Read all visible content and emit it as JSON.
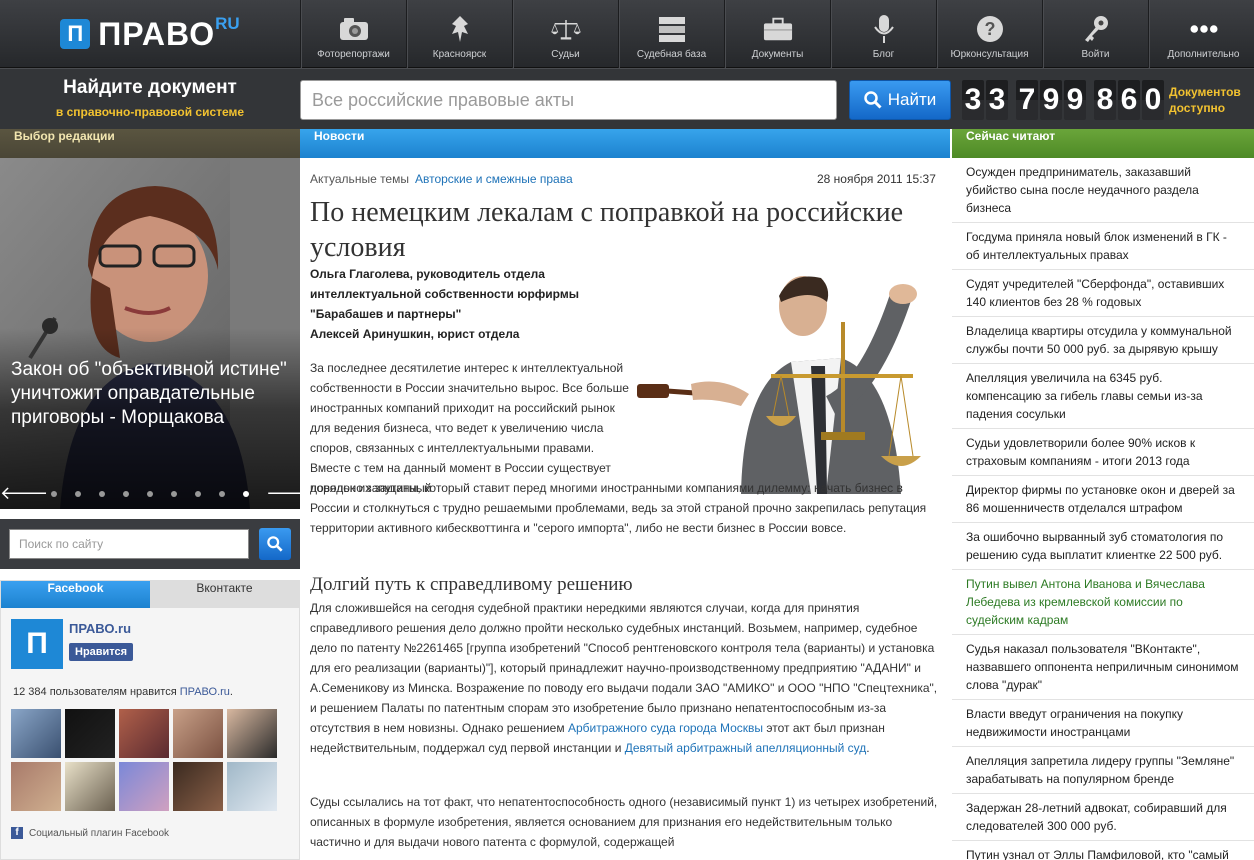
{
  "brand": {
    "mark": "П",
    "name": "ПРАВО",
    "suffix": "RU"
  },
  "nav": [
    {
      "label": "Фоторепортажи",
      "icon": "camera-icon"
    },
    {
      "label": "Красноярск",
      "icon": "city-emblem-icon"
    },
    {
      "label": "Судьи",
      "icon": "scales-icon"
    },
    {
      "label": "Судебная база",
      "icon": "database-icon"
    },
    {
      "label": "Документы",
      "icon": "briefcase-icon"
    },
    {
      "label": "Блог",
      "icon": "microphone-icon"
    },
    {
      "label": "Юрконсультация",
      "icon": "question-icon"
    },
    {
      "label": "Войти",
      "icon": "keys-icon"
    },
    {
      "label": "Дополнительно",
      "icon": "more-dots-icon"
    }
  ],
  "docsearch": {
    "title": "Найдите документ",
    "subtitle": "в справочно-правовой системе",
    "placeholder": "Все российские правовые акты",
    "button": "Найти"
  },
  "counter": {
    "digits": [
      "3",
      "3",
      "7",
      "9",
      "9",
      "8",
      "6",
      "0"
    ],
    "label1": "Документов",
    "label2": "доступно"
  },
  "columns": {
    "left": "Выбор редакции",
    "mid": "Новости",
    "right": "Сейчас читают"
  },
  "feature": {
    "title": "Закон об \"объективной истине\" уничтожит оправдательные приговоры - Морщакова",
    "prev": "🡐",
    "next": "🡒",
    "dots": 9,
    "active_dot": 8
  },
  "sitesearch": {
    "placeholder": "Поиск по сайту"
  },
  "social": {
    "tab_fb": "Facebook",
    "tab_vk": "Вконтакте",
    "fb_mark": "П",
    "page_name": "ПРАВО.ru",
    "like_label": "Нравится",
    "count_text": "12 384 пользователям нравится ",
    "count_link": "ПРАВО.ru",
    "count_end": ".",
    "plugin": "Социальный плагин Facebook",
    "fb_letter": "f"
  },
  "article": {
    "crumb1": "Актуальные темы",
    "crumb2": "Авторские и смежные права",
    "date": "28 ноября 2011 15:37",
    "title": "По немецким лекалам с поправкой на российские условия",
    "authors": [
      "Ольга Глаголева, руководитель отдела",
      "интеллектуальной собственности юрфирмы",
      "\"Барабашев и партнеры\"",
      "Алексей Аринушкин, юрист отдела"
    ],
    "p1": "За последнее десятилетие интерес к интеллектуальной собственности в России значительно вырос. Все больше иностранных компаний приходит на российский рынок для ведения бизнеса, что ведет к увеличению числа споров, связанных с интеллектуальными правами. Вместе с тем на данный момент в России существует довольно запутанный",
    "p1b": "порядок их защиты, который ставит перед многими иностранными компаниями дилемму: начать бизнес в России и столкнуться с трудно решаемыми проблемами, ведь за этой страной прочно закрепилась репутация территории активного кибесквоттинга и \"серого импорта\", либо не вести бизнес в России вовсе.",
    "subhead": "Долгий путь к справедливому решению",
    "p2a": "Для сложившейся на сегодня судебной практики нередкими являются случаи, когда для принятия справедливого решения дело должно пройти несколько судебных инстанций. Возьмем, например, судебное дело по патенту №2261465 [группа изобретений \"Способ рентгеновского контроля тела (варианты) и установка для его реализации (варианты)\"], который принадлежит научно-производственному предприятию \"АДАНИ\" и А.Семеникову из Минска. Возражение по поводу его выдачи подали ЗАО \"АМИКО\" и ООО \"НПО \"Спецтехника\", и решением Палаты по патентным спорам это изобретение было признано непатентоспособным из-за отсутствия в нем новизны. Однако решением ",
    "p2link1": "Арбитражного суда города Москвы",
    "p2b": " этот акт был признан недействительным, поддержал суд первой инстанции и ",
    "p2link2": "Девятый арбитражный апелляционный суд",
    "p2c": ".",
    "p3": "Суды ссылались на тот факт, что непатентоспособность одного (независимый пункт 1) из четырех изобретений, описанных в формуле изобретения, является основанием для признания его недействительным только частично и для выдачи нового патента с формулой, содержащей"
  },
  "reading": [
    {
      "text": "Осужден предприниматель, заказавший убийство сына после неудачного раздела бизнеса",
      "green": false
    },
    {
      "text": "Госдума приняла новый блок изменений в ГК - об интеллектуальных правах",
      "green": false
    },
    {
      "text": "Судят учредителей \"Сберфонда\", оставивших 140 клиентов без 28 % годовых",
      "green": false
    },
    {
      "text": "Владелица квартиры отсудила у коммунальной службы почти 50 000 руб. за дырявую крышу",
      "green": false
    },
    {
      "text": "Апелляция увеличила на 6345 руб. компенсацию за гибель главы семьи из-за падения сосульки",
      "green": false
    },
    {
      "text": "Судьи удовлетворили более 90% исков к страховым компаниям - итоги 2013 года",
      "green": false
    },
    {
      "text": "Директор фирмы по установке окон и дверей за 86 мошенничеств отделался штрафом",
      "green": false
    },
    {
      "text": "За ошибочно вырванный зуб стоматология по решению суда выплатит клиентке 22 500 руб.",
      "green": false
    },
    {
      "text": "Путин вывел Антона Иванова и Вячеслава Лебедева из кремлевской комиссии по судейским кадрам",
      "green": true
    },
    {
      "text": "Судья наказал пользователя \"ВКонтакте\", назвавшего оппонента неприличным синонимом слова \"дурак\"",
      "green": false
    },
    {
      "text": "Власти введут ограничения на покупку недвижимости иностранцами",
      "green": false
    },
    {
      "text": "Апелляция запретила лидеру группы \"Земляне\" зарабатывать на популярном бренде",
      "green": false
    },
    {
      "text": "Задержан 28-летний адвокат, собиравший для следователей 300 000 руб.",
      "green": false
    },
    {
      "text": "Путин узнал от Эллы Памфиловой, кто \"самый лучший правозащитник\"",
      "green": false
    }
  ]
}
